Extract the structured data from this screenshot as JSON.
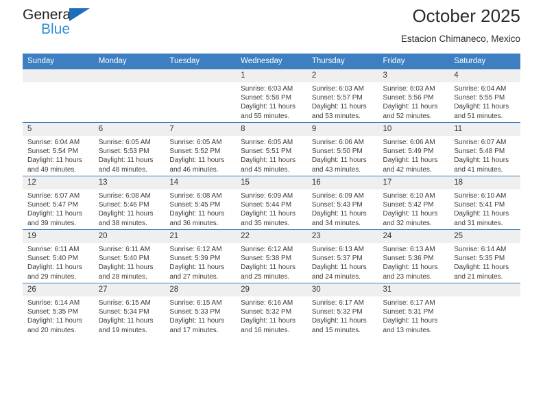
{
  "logo": {
    "line1": "General",
    "line2": "Blue",
    "triangle_color": "#1c6fba",
    "line2_color": "#2e8fd6"
  },
  "header": {
    "title": "October 2025",
    "subtitle": "Estacion Chimaneco, Mexico"
  },
  "calendar": {
    "header_bg": "#3d7fc1",
    "daynum_bg": "#efefef",
    "weekdays": [
      "Sunday",
      "Monday",
      "Tuesday",
      "Wednesday",
      "Thursday",
      "Friday",
      "Saturday"
    ],
    "weeks": [
      [
        {
          "day": "",
          "sunrise": "",
          "sunset": "",
          "daylight1": "",
          "daylight2": ""
        },
        {
          "day": "",
          "sunrise": "",
          "sunset": "",
          "daylight1": "",
          "daylight2": ""
        },
        {
          "day": "",
          "sunrise": "",
          "sunset": "",
          "daylight1": "",
          "daylight2": ""
        },
        {
          "day": "1",
          "sunrise": "Sunrise: 6:03 AM",
          "sunset": "Sunset: 5:58 PM",
          "daylight1": "Daylight: 11 hours",
          "daylight2": "and 55 minutes."
        },
        {
          "day": "2",
          "sunrise": "Sunrise: 6:03 AM",
          "sunset": "Sunset: 5:57 PM",
          "daylight1": "Daylight: 11 hours",
          "daylight2": "and 53 minutes."
        },
        {
          "day": "3",
          "sunrise": "Sunrise: 6:03 AM",
          "sunset": "Sunset: 5:56 PM",
          "daylight1": "Daylight: 11 hours",
          "daylight2": "and 52 minutes."
        },
        {
          "day": "4",
          "sunrise": "Sunrise: 6:04 AM",
          "sunset": "Sunset: 5:55 PM",
          "daylight1": "Daylight: 11 hours",
          "daylight2": "and 51 minutes."
        }
      ],
      [
        {
          "day": "5",
          "sunrise": "Sunrise: 6:04 AM",
          "sunset": "Sunset: 5:54 PM",
          "daylight1": "Daylight: 11 hours",
          "daylight2": "and 49 minutes."
        },
        {
          "day": "6",
          "sunrise": "Sunrise: 6:05 AM",
          "sunset": "Sunset: 5:53 PM",
          "daylight1": "Daylight: 11 hours",
          "daylight2": "and 48 minutes."
        },
        {
          "day": "7",
          "sunrise": "Sunrise: 6:05 AM",
          "sunset": "Sunset: 5:52 PM",
          "daylight1": "Daylight: 11 hours",
          "daylight2": "and 46 minutes."
        },
        {
          "day": "8",
          "sunrise": "Sunrise: 6:05 AM",
          "sunset": "Sunset: 5:51 PM",
          "daylight1": "Daylight: 11 hours",
          "daylight2": "and 45 minutes."
        },
        {
          "day": "9",
          "sunrise": "Sunrise: 6:06 AM",
          "sunset": "Sunset: 5:50 PM",
          "daylight1": "Daylight: 11 hours",
          "daylight2": "and 43 minutes."
        },
        {
          "day": "10",
          "sunrise": "Sunrise: 6:06 AM",
          "sunset": "Sunset: 5:49 PM",
          "daylight1": "Daylight: 11 hours",
          "daylight2": "and 42 minutes."
        },
        {
          "day": "11",
          "sunrise": "Sunrise: 6:07 AM",
          "sunset": "Sunset: 5:48 PM",
          "daylight1": "Daylight: 11 hours",
          "daylight2": "and 41 minutes."
        }
      ],
      [
        {
          "day": "12",
          "sunrise": "Sunrise: 6:07 AM",
          "sunset": "Sunset: 5:47 PM",
          "daylight1": "Daylight: 11 hours",
          "daylight2": "and 39 minutes."
        },
        {
          "day": "13",
          "sunrise": "Sunrise: 6:08 AM",
          "sunset": "Sunset: 5:46 PM",
          "daylight1": "Daylight: 11 hours",
          "daylight2": "and 38 minutes."
        },
        {
          "day": "14",
          "sunrise": "Sunrise: 6:08 AM",
          "sunset": "Sunset: 5:45 PM",
          "daylight1": "Daylight: 11 hours",
          "daylight2": "and 36 minutes."
        },
        {
          "day": "15",
          "sunrise": "Sunrise: 6:09 AM",
          "sunset": "Sunset: 5:44 PM",
          "daylight1": "Daylight: 11 hours",
          "daylight2": "and 35 minutes."
        },
        {
          "day": "16",
          "sunrise": "Sunrise: 6:09 AM",
          "sunset": "Sunset: 5:43 PM",
          "daylight1": "Daylight: 11 hours",
          "daylight2": "and 34 minutes."
        },
        {
          "day": "17",
          "sunrise": "Sunrise: 6:10 AM",
          "sunset": "Sunset: 5:42 PM",
          "daylight1": "Daylight: 11 hours",
          "daylight2": "and 32 minutes."
        },
        {
          "day": "18",
          "sunrise": "Sunrise: 6:10 AM",
          "sunset": "Sunset: 5:41 PM",
          "daylight1": "Daylight: 11 hours",
          "daylight2": "and 31 minutes."
        }
      ],
      [
        {
          "day": "19",
          "sunrise": "Sunrise: 6:11 AM",
          "sunset": "Sunset: 5:40 PM",
          "daylight1": "Daylight: 11 hours",
          "daylight2": "and 29 minutes."
        },
        {
          "day": "20",
          "sunrise": "Sunrise: 6:11 AM",
          "sunset": "Sunset: 5:40 PM",
          "daylight1": "Daylight: 11 hours",
          "daylight2": "and 28 minutes."
        },
        {
          "day": "21",
          "sunrise": "Sunrise: 6:12 AM",
          "sunset": "Sunset: 5:39 PM",
          "daylight1": "Daylight: 11 hours",
          "daylight2": "and 27 minutes."
        },
        {
          "day": "22",
          "sunrise": "Sunrise: 6:12 AM",
          "sunset": "Sunset: 5:38 PM",
          "daylight1": "Daylight: 11 hours",
          "daylight2": "and 25 minutes."
        },
        {
          "day": "23",
          "sunrise": "Sunrise: 6:13 AM",
          "sunset": "Sunset: 5:37 PM",
          "daylight1": "Daylight: 11 hours",
          "daylight2": "and 24 minutes."
        },
        {
          "day": "24",
          "sunrise": "Sunrise: 6:13 AM",
          "sunset": "Sunset: 5:36 PM",
          "daylight1": "Daylight: 11 hours",
          "daylight2": "and 23 minutes."
        },
        {
          "day": "25",
          "sunrise": "Sunrise: 6:14 AM",
          "sunset": "Sunset: 5:35 PM",
          "daylight1": "Daylight: 11 hours",
          "daylight2": "and 21 minutes."
        }
      ],
      [
        {
          "day": "26",
          "sunrise": "Sunrise: 6:14 AM",
          "sunset": "Sunset: 5:35 PM",
          "daylight1": "Daylight: 11 hours",
          "daylight2": "and 20 minutes."
        },
        {
          "day": "27",
          "sunrise": "Sunrise: 6:15 AM",
          "sunset": "Sunset: 5:34 PM",
          "daylight1": "Daylight: 11 hours",
          "daylight2": "and 19 minutes."
        },
        {
          "day": "28",
          "sunrise": "Sunrise: 6:15 AM",
          "sunset": "Sunset: 5:33 PM",
          "daylight1": "Daylight: 11 hours",
          "daylight2": "and 17 minutes."
        },
        {
          "day": "29",
          "sunrise": "Sunrise: 6:16 AM",
          "sunset": "Sunset: 5:32 PM",
          "daylight1": "Daylight: 11 hours",
          "daylight2": "and 16 minutes."
        },
        {
          "day": "30",
          "sunrise": "Sunrise: 6:17 AM",
          "sunset": "Sunset: 5:32 PM",
          "daylight1": "Daylight: 11 hours",
          "daylight2": "and 15 minutes."
        },
        {
          "day": "31",
          "sunrise": "Sunrise: 6:17 AM",
          "sunset": "Sunset: 5:31 PM",
          "daylight1": "Daylight: 11 hours",
          "daylight2": "and 13 minutes."
        },
        {
          "day": "",
          "sunrise": "",
          "sunset": "",
          "daylight1": "",
          "daylight2": ""
        }
      ]
    ]
  }
}
